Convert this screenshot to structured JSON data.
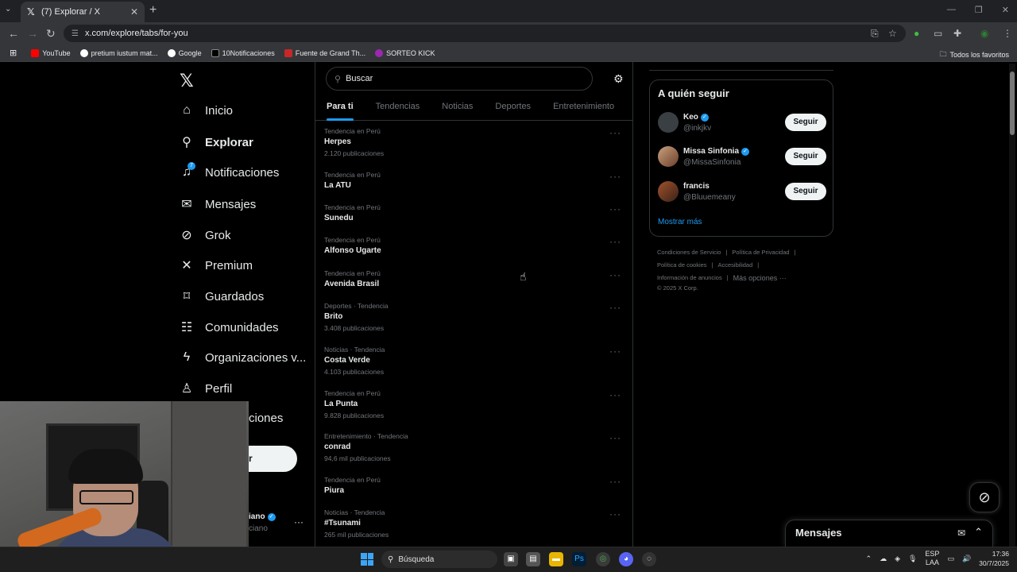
{
  "browser": {
    "tab_title": "(7) Explorar / X",
    "url": "x.com/explore/tabs/for-you",
    "bookmarks": [
      "YouTube",
      "pretium iustum mat...",
      "Google",
      "10Notificaciones",
      "Fuente de Grand Th...",
      "SORTEO KICK"
    ],
    "all_bookmarks": "Todos los favoritos"
  },
  "nav": {
    "items": [
      {
        "label": "Inicio",
        "icon": "home-icon"
      },
      {
        "label": "Explorar",
        "icon": "search-icon"
      },
      {
        "label": "Notificaciones",
        "icon": "bell-icon",
        "badge": "7"
      },
      {
        "label": "Mensajes",
        "icon": "mail-icon"
      },
      {
        "label": "Grok",
        "icon": "grok-icon"
      },
      {
        "label": "Premium",
        "icon": "x-icon"
      },
      {
        "label": "Guardados",
        "icon": "bookmark-icon"
      },
      {
        "label": "Comunidades",
        "icon": "people-icon"
      },
      {
        "label": "Organizaciones v...",
        "icon": "lightning-icon"
      },
      {
        "label": "Perfil",
        "icon": "person-icon"
      },
      {
        "label": "ciones"
      }
    ],
    "post_button_partial": "r",
    "profile_name_partial": "iano",
    "profile_handle_partial": "ciano"
  },
  "search": {
    "placeholder": "Buscar"
  },
  "tabs": [
    "Para ti",
    "Tendencias",
    "Noticias",
    "Deportes",
    "Entretenimiento"
  ],
  "trends": [
    {
      "ctx": "Tendencia en Perú",
      "name": "Herpes",
      "count": "2.120 publicaciones"
    },
    {
      "ctx": "Tendencia en Perú",
      "name": "La ATU",
      "count": ""
    },
    {
      "ctx": "Tendencia en Perú",
      "name": "Sunedu",
      "count": ""
    },
    {
      "ctx": "Tendencia en Perú",
      "name": "Alfonso Ugarte",
      "count": ""
    },
    {
      "ctx": "Tendencia en Perú",
      "name": "Avenida Brasil",
      "count": ""
    },
    {
      "ctx": "Deportes · Tendencia",
      "name": "Brito",
      "count": "3.408 publicaciones"
    },
    {
      "ctx": "Noticias · Tendencia",
      "name": "Costa Verde",
      "count": "4.103 publicaciones"
    },
    {
      "ctx": "Tendencia en Perú",
      "name": "La Punta",
      "count": "9.828 publicaciones"
    },
    {
      "ctx": "Entretenimiento · Tendencia",
      "name": "conrad",
      "count": "94,6 mil publicaciones"
    },
    {
      "ctx": "Tendencia en Perú",
      "name": "Piura",
      "count": ""
    },
    {
      "ctx": "Noticias · Tendencia",
      "name": "#Tsunami",
      "count": "265 mil publicaciones"
    }
  ],
  "who_to_follow": {
    "title": "A quién seguir",
    "follow_label": "Seguir",
    "users": [
      {
        "name": "Keo",
        "handle": "@inkjkv",
        "verified": true
      },
      {
        "name": "Missa Sinfonia",
        "handle": "@MissaSinfonia",
        "verified": true
      },
      {
        "name": "francis",
        "handle": "@Bluuemeany",
        "verified": false
      }
    ],
    "show_more": "Mostrar más"
  },
  "footer": {
    "links": [
      "Condiciones de Servicio",
      "Política de Privacidad",
      "Política de cookies",
      "Accesibilidad",
      "Información de anuncios",
      "Más opciones ···"
    ],
    "copyright": "© 2025 X Corp."
  },
  "messages": {
    "title": "Mensajes"
  },
  "taskbar": {
    "search": "Búsqueda",
    "lang": "ESP",
    "lang2": "LAA",
    "time": "17:36",
    "date": "30/7/2025"
  },
  "colors": {
    "accent": "#1d9bf0",
    "bg": "#000000",
    "muted": "#71767b"
  }
}
